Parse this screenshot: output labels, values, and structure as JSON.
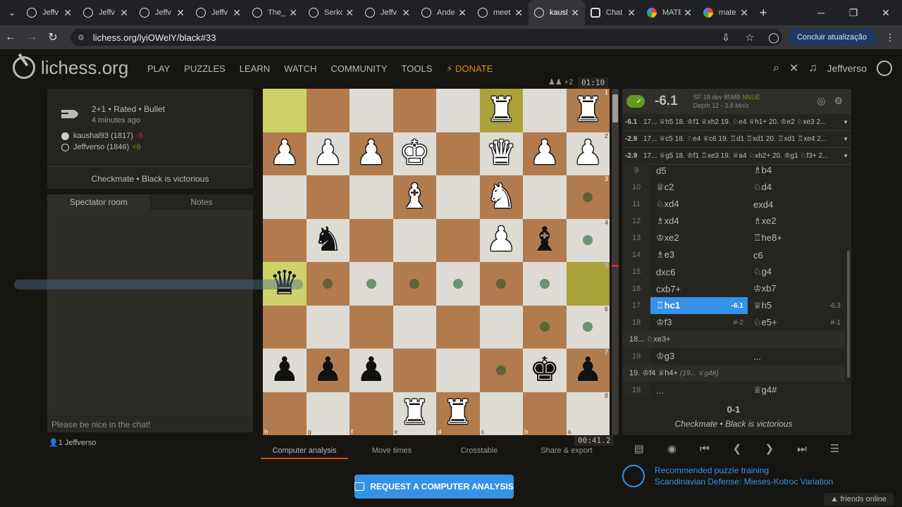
{
  "browser": {
    "tabs": [
      "Jeffv",
      "Jeffv",
      "Jeffv",
      "Jeffv",
      "The_I",
      "Serkc",
      "Jeffv",
      "Ande",
      "meet",
      "kausl",
      "Chat",
      "MATE",
      "mate"
    ],
    "active_tab": 9,
    "url": "lichess.org/lyiOWelY/black#33",
    "update_button": "Concluir atualização"
  },
  "site": {
    "logo": "lichess.org",
    "nav": [
      "PLAY",
      "PUZZLES",
      "LEARN",
      "WATCH",
      "COMMUNITY",
      "TOOLS"
    ],
    "donate": "DONATE",
    "username": "Jeffverso"
  },
  "game": {
    "title": "2+1 • Rated • Bullet",
    "time_ago": "4 minutes ago",
    "white": {
      "name": "kaushal93 (1817)",
      "diff": "-5",
      "diff_color": "#cc3333"
    },
    "black": {
      "name": "Jeffverso (1846)",
      "diff": "+6",
      "diff_color": "#629924"
    },
    "status": "Checkmate • Black is victorious"
  },
  "chat": {
    "tab_spectator": "Spectator room",
    "tab_notes": "Notes",
    "placeholder": "Please be nice in the chat!",
    "spectators": "1 Jeffverso"
  },
  "board": {
    "material_top": "+2",
    "clock_top": "01:10",
    "clock_bottom": "00:41.2",
    "ranks": [
      "1",
      "2",
      "3",
      "4",
      "5",
      "6",
      "7",
      "8"
    ],
    "files": [
      "h",
      "g",
      "f",
      "e",
      "d",
      "c",
      "b",
      "a"
    ],
    "rows": [
      [
        "",
        "",
        "",
        "",
        "",
        "♜w",
        "",
        "♜w"
      ],
      [
        "♟w",
        "♟w",
        "♟w",
        "♚w",
        "",
        "♛w",
        "♟w",
        "♟w"
      ],
      [
        "",
        "",
        "",
        "♝w",
        "",
        "♞w",
        "",
        ""
      ],
      [
        "",
        "♞b",
        "",
        "",
        "",
        "♟w",
        "♝b",
        ""
      ],
      [
        "♛b",
        "",
        "",
        "",
        "",
        "",
        "",
        ""
      ],
      [
        "",
        "",
        "",
        "",
        "",
        "",
        "",
        ""
      ],
      [
        "♟b",
        "♟b",
        "♟b",
        "",
        "",
        "",
        "♚b",
        "♟b"
      ],
      [
        "",
        "",
        "",
        "♜w",
        "♜w",
        "",
        "",
        ""
      ]
    ]
  },
  "tabs_below": [
    "Computer analysis",
    "Move times",
    "Crosstable",
    "Share & export"
  ],
  "request_button": "REQUEST A COMPUTER ANALYSIS",
  "engine": {
    "score": "-6.1",
    "name": "SF 18 dev 85MB",
    "nnue": "NNUE",
    "depth": "Depth 12 - 3.8 Mn/s",
    "pvs": [
      {
        "eval": "-6.1",
        "line": "17... ♕h5 18. ♔f1 ♕xh2 19. ♘e4 ♕h1+ 20. ♔e2 ♘xe3 2..."
      },
      {
        "eval": "-2.9",
        "line": "17... ♕c5 18. ♘e4 ♕c6 19. ♖d1 ♖xd1 20. ♖xd1 ♖xe4 2..."
      },
      {
        "eval": "-2.9",
        "line": "17... ♕g5 18. ♔f1 ♖xe3 19. ♕a4 ♘xh2+ 20. ♔g1 ♘f3+ 2..."
      }
    ]
  },
  "moves": [
    {
      "n": "9",
      "w": "d5",
      "b": "♗b4"
    },
    {
      "n": "10",
      "w": "♕c2",
      "b": "♘d4"
    },
    {
      "n": "11",
      "w": "♘xd4",
      "b": "exd4"
    },
    {
      "n": "12",
      "w": "♗xd4",
      "b": "♗xe2"
    },
    {
      "n": "13",
      "w": "♔xe2",
      "b": "♖he8+"
    },
    {
      "n": "14",
      "w": "♗e3",
      "b": "c6"
    },
    {
      "n": "15",
      "w": "dxc6",
      "b": "♘g4"
    },
    {
      "n": "16",
      "w": "cxb7+",
      "b": "♔xb7"
    },
    {
      "n": "17",
      "w": "♖hc1",
      "we": "-6.1",
      "b": "♕h5",
      "be": "-6.3",
      "cur": "w"
    },
    {
      "n": "18",
      "w": "♔f3",
      "we": "#-2",
      "b": "♘e5+",
      "be": "#-1"
    }
  ],
  "variation1": "18... ♘xe3+",
  "move19a": {
    "n": "19",
    "w": "♔g3",
    "b": "..."
  },
  "variation2": {
    "text": "19. ♔f4  ♕h4+",
    "note": "(19... ♕g4#)"
  },
  "move19b": {
    "n": "19",
    "w": "...",
    "b": "♕g4#"
  },
  "result": {
    "score": "0-1",
    "status": "Checkmate • Black is victorious"
  },
  "puzzle": {
    "line1": "Recommended puzzle training",
    "line2": "Scandinavian Defense: Mieses-Kotroc Variation"
  },
  "friends": "friends online"
}
